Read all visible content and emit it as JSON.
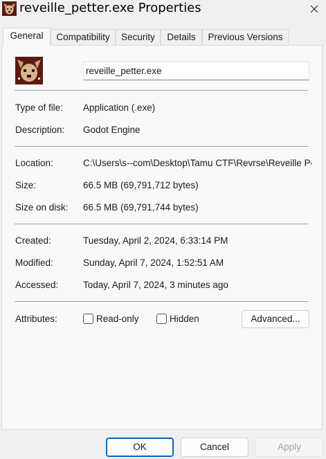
{
  "window": {
    "title": "reveille_petter.exe Properties",
    "icons": {
      "app": "dog-face-icon",
      "close": "close-icon"
    }
  },
  "tabs": [
    {
      "label": "General",
      "active": true
    },
    {
      "label": "Compatibility",
      "active": false
    },
    {
      "label": "Security",
      "active": false
    },
    {
      "label": "Details",
      "active": false
    },
    {
      "label": "Previous Versions",
      "active": false
    }
  ],
  "general": {
    "filename": "reveille_petter.exe",
    "type": {
      "label": "Type of file:",
      "value": "Application (.exe)"
    },
    "description": {
      "label": "Description:",
      "value": "Godot Engine"
    },
    "location": {
      "label": "Location:",
      "value": "C:\\Users\\s--com\\Desktop\\Tamu CTF\\Revrse\\Reveille Petter"
    },
    "size": {
      "label": "Size:",
      "value": "66.5 MB (69,791,712 bytes)"
    },
    "size_on_disk": {
      "label": "Size on disk:",
      "value": "66.5 MB (69,791,744 bytes)"
    },
    "created": {
      "label": "Created:",
      "value": "Tuesday, April 2, 2024, 6:33:14 PM"
    },
    "modified": {
      "label": "Modified:",
      "value": "Sunday, April 7, 2024, 1:52:51 AM"
    },
    "accessed": {
      "label": "Accessed:",
      "value": "Today, April 7, 2024, 3 minutes ago"
    },
    "attributes": {
      "label": "Attributes:",
      "readonly_label": "Read-only",
      "readonly_checked": false,
      "hidden_label": "Hidden",
      "hidden_checked": false,
      "advanced_label": "Advanced..."
    }
  },
  "buttons": {
    "ok": "OK",
    "cancel": "Cancel",
    "apply": "Apply"
  },
  "colors": {
    "accent": "#0067c0",
    "icon_bg": "#5a1a12"
  }
}
